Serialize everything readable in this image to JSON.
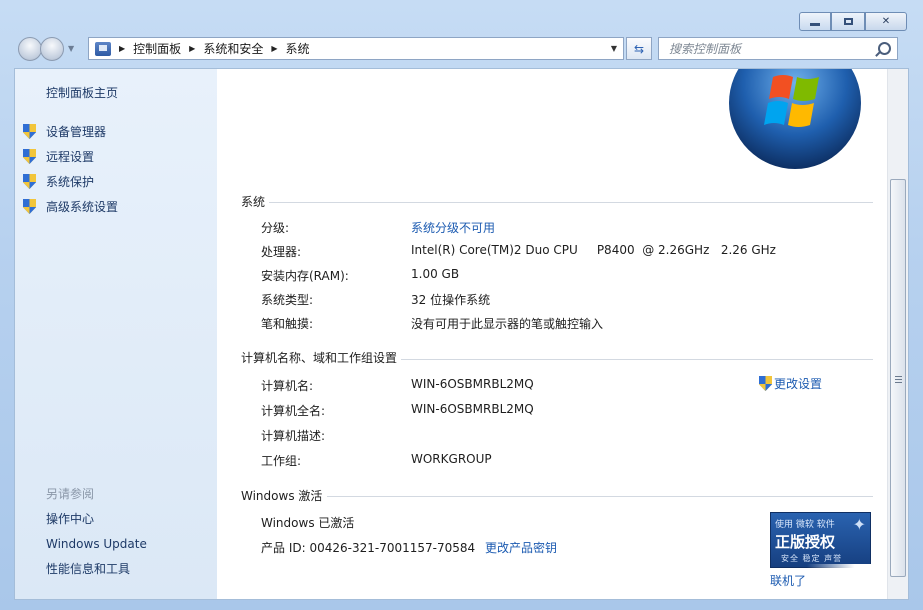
{
  "window": {
    "minimize_glyph": "minimize-icon",
    "maximize_glyph": "maximize-icon",
    "close_glyph": "✕"
  },
  "address": {
    "breadcrumbs": [
      "控制面板",
      "系统和安全",
      "系统"
    ]
  },
  "search": {
    "placeholder": "搜索控制面板"
  },
  "sidebar": {
    "home": "控制面板主页",
    "tasks": [
      {
        "label": "设备管理器",
        "icon": "shield-icon"
      },
      {
        "label": "远程设置",
        "icon": "shield-icon"
      },
      {
        "label": "系统保护",
        "icon": "shield-icon"
      },
      {
        "label": "高级系统设置",
        "icon": "shield-icon"
      }
    ],
    "see_also_title": "另请参阅",
    "see_also": [
      "操作中心",
      "Windows Update",
      "性能信息和工具"
    ]
  },
  "system": {
    "title": "系统",
    "rows": [
      {
        "label": "分级:",
        "value": "系统分级不可用"
      },
      {
        "label": "处理器:",
        "value": "Intel(R) Core(TM)2 Duo CPU     P8400  @ 2.26GHz   2.26 GHz"
      },
      {
        "label": "安装内存(RAM):",
        "value": "1.00 GB"
      },
      {
        "label": "系统类型:",
        "value": "32 位操作系统"
      },
      {
        "label": "笔和触摸:",
        "value": "没有可用于此显示器的笔或触控输入"
      }
    ]
  },
  "computer": {
    "title": "计算机名称、域和工作组设置",
    "change_settings": "更改设置",
    "rows": [
      {
        "label": "计算机名:",
        "value": "WIN-6OSBMRBL2MQ"
      },
      {
        "label": "计算机全名:",
        "value": "WIN-6OSBMRBL2MQ"
      },
      {
        "label": "计算机描述:",
        "value": ""
      },
      {
        "label": "工作组:",
        "value": "WORKGROUP"
      }
    ]
  },
  "activation": {
    "title": "Windows 激活",
    "status": "Windows 已激活",
    "product_id": "产品 ID: 00426-321-7001157-70584",
    "change_key": "更改产品密钥",
    "badge_top": "使用 微软 软件",
    "badge_main": "正版授权",
    "badge_bottom": "安全 稳定 声誉",
    "learn_more": "联机了"
  },
  "colors": {
    "link": "#1c5bb1",
    "sidebar_bg": "#e8f1fb",
    "frame_bg": "#b7d1ef"
  }
}
